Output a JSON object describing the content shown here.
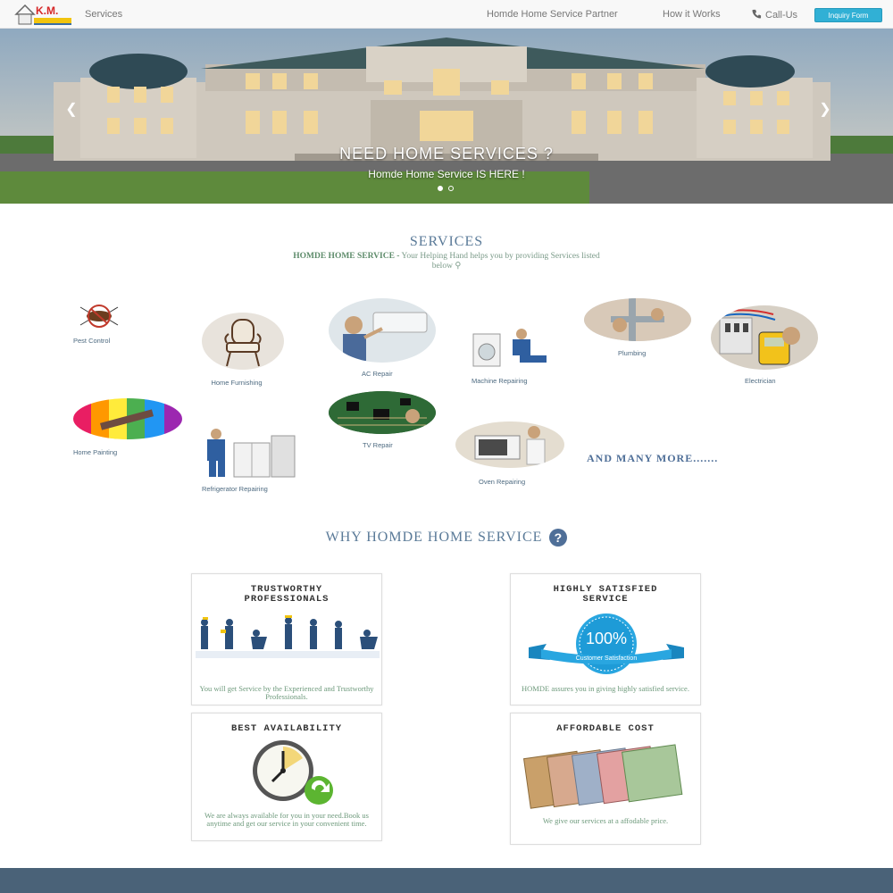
{
  "navbar": {
    "logo_text": "K.M.",
    "services": "Services",
    "partner": "Homde Home Service Partner",
    "how_it_works": "How it Works",
    "call_us": "Call-Us",
    "inquiry_button": "Inquiry Form"
  },
  "hero": {
    "title": "NEED HOME SERVICES ?",
    "subtitle": "Homde Home Service IS HERE !",
    "slides_count": 2,
    "active_slide": 1
  },
  "services": {
    "title": "SERVICES",
    "intro_bold": "HOMDE HOME SERVICE -",
    "intro_text": " Your Helping Hand helps you by providing Services listed below",
    "items": [
      {
        "label": "Pest Control"
      },
      {
        "label": "Home Furnishing"
      },
      {
        "label": "AC Repair"
      },
      {
        "label": "Machine Repairing"
      },
      {
        "label": "Plumbing"
      },
      {
        "label": "Electrician"
      },
      {
        "label": "Home Painting"
      },
      {
        "label": "Refrigerator Repairing"
      },
      {
        "label": "TV Repair"
      },
      {
        "label": "Oven Repairing"
      }
    ],
    "many_more": "AND MANY MORE......."
  },
  "why": {
    "title": "WHY HOMDE HOME SERVICE",
    "cards": [
      {
        "title": "TRUSTWORTHY PROFESSIONALS",
        "text": "You will get Service by the Experienced and Trustworthy Professionals."
      },
      {
        "title": "HIGHLY SATISFIED SERVICE",
        "text": "HOMDE assures you in giving highly satisfied service.",
        "badge_value": "100%",
        "badge_text": "Customer Satisfaction"
      },
      {
        "title": "BEST AVAILABILITY",
        "text": "We are always available for you in your need.Book us anytime and get our service in your convenient time."
      },
      {
        "title": "AFFORDABLE COST",
        "text": "We give our services at a affodable price."
      }
    ]
  },
  "colors": {
    "heading": "#5a7a98",
    "accent_button": "#31b0d5",
    "footer": "#4a6278"
  }
}
